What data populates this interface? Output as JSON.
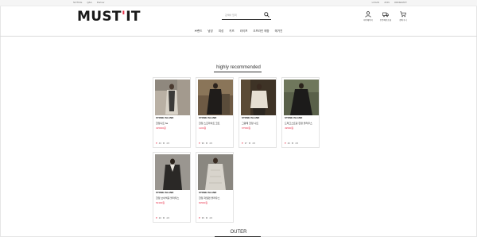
{
  "util_bar": {
    "left": [
      "NOTICE",
      "Q&A",
      "Partner"
    ],
    "right": [
      "LOGIN",
      "JOIN",
      "ORDER/MY"
    ]
  },
  "header": {
    "logo_text": "MUST",
    "logo_apostrophe": "'",
    "logo_text_end": "IT",
    "search_placeholder": "검색어 입력",
    "icons": [
      {
        "name": "user-icon",
        "label": "마이페이지"
      },
      {
        "name": "truck-icon",
        "label": "주문/배송조회"
      },
      {
        "name": "cart-icon",
        "label": "장바구니"
      }
    ]
  },
  "nav": {
    "items": [
      "브랜드",
      "남성",
      "여성",
      "키즈",
      "라이프",
      "오프라인 매장",
      "매거진"
    ]
  },
  "sections": {
    "recommended_title": "highly recommended",
    "outer_title": "OUTER"
  },
  "products": [
    {
      "brand": "STONE ISLAND",
      "name": "한정니트 6a",
      "price": "325000원",
      "likes": "43",
      "rating": "4.5"
    },
    {
      "brand": "STONE ISLAND",
      "name": "한정 스프라이트 코트",
      "price": "1100원",
      "likes": "96",
      "rating": "4.5"
    },
    {
      "brand": "STONE ISLAND",
      "name": "그랑떼 한정 니트",
      "price": "67500원",
      "likes": "37",
      "rating": "4.5"
    },
    {
      "brand": "STONE ISLAND",
      "name": "드래그스트링 한정 블라우스",
      "price": "49500원",
      "likes": "40",
      "rating": "4.5"
    },
    {
      "brand": "STONE ISLAND",
      "name": "한정 브이넥큐 블라우스",
      "price": "54300원",
      "likes": "20",
      "rating": "4.5"
    },
    {
      "brand": "STONE ISLAND",
      "name": "한정 자일렌 블라우스",
      "price": "60500원",
      "likes": "35",
      "rating": "4.5"
    }
  ],
  "colors": {
    "accent": "#e8314a",
    "text": "#222222",
    "border": "#e4e4e4"
  }
}
